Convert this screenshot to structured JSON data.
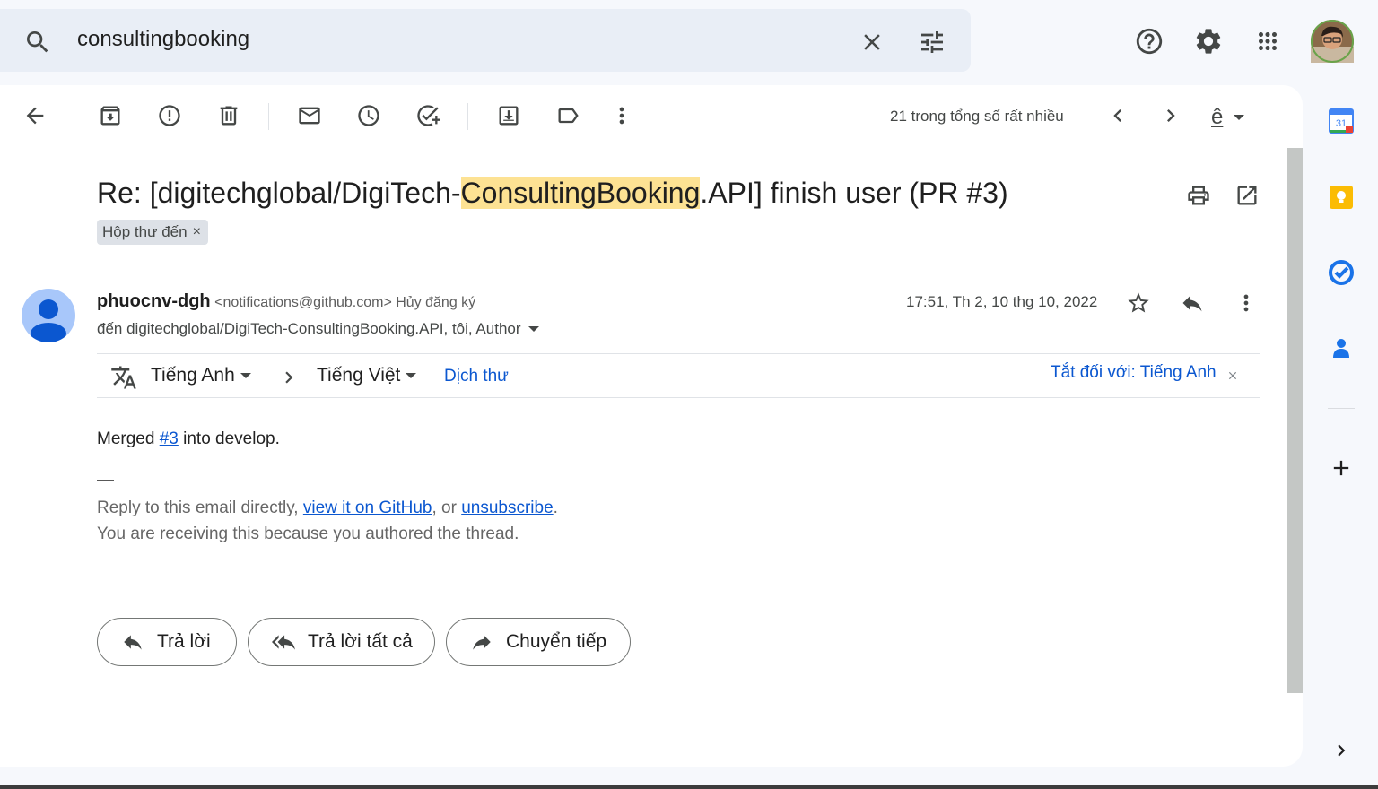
{
  "search": {
    "query": "consultingbooking"
  },
  "toolbar": {
    "pager_text": "21 trong tổng số rất nhiều",
    "input_tools_label": "ê"
  },
  "email": {
    "subject_prefix": "Re: [digitechglobal/DigiTech-",
    "subject_highlight": "ConsultingBooking",
    "subject_suffix": ".API] finish user (PR #3)",
    "label": "Hộp thư đến",
    "label_remove": "×",
    "sender_name": "phuocnv-dgh",
    "sender_email": "<notifications@github.com>",
    "unsubscribe": "Hủy đăng ký",
    "to_line": "đến digitechglobal/DigiTech-ConsultingBooking.API, tôi, Author",
    "date": "17:51, Th 2, 10 thg 10, 2022"
  },
  "translate": {
    "source_lang": "Tiếng Anh",
    "target_lang": "Tiếng Việt",
    "translate_link": "Dịch thư",
    "turn_off": "Tắt đối với: Tiếng Anh"
  },
  "body": {
    "merged_prefix": "Merged ",
    "merged_link": "#3",
    "merged_suffix": " into develop.",
    "dash": "—",
    "reply_prefix": "Reply to this email directly, ",
    "view_link": "view it on GitHub",
    "reply_middle": ", or ",
    "unsubscribe_link": "unsubscribe",
    "reply_suffix": ".",
    "receiving": "You are receiving this because you authored the thread."
  },
  "actions": {
    "reply": "Trả lời",
    "reply_all": "Trả lời tất cả",
    "forward": "Chuyển tiếp"
  },
  "side_panel": {
    "calendar_day": "31"
  },
  "colors": {
    "accent": "#0b57d0",
    "highlight": "#fde293",
    "search_bg": "#e9eef6",
    "page_bg": "#f6f8fc"
  }
}
